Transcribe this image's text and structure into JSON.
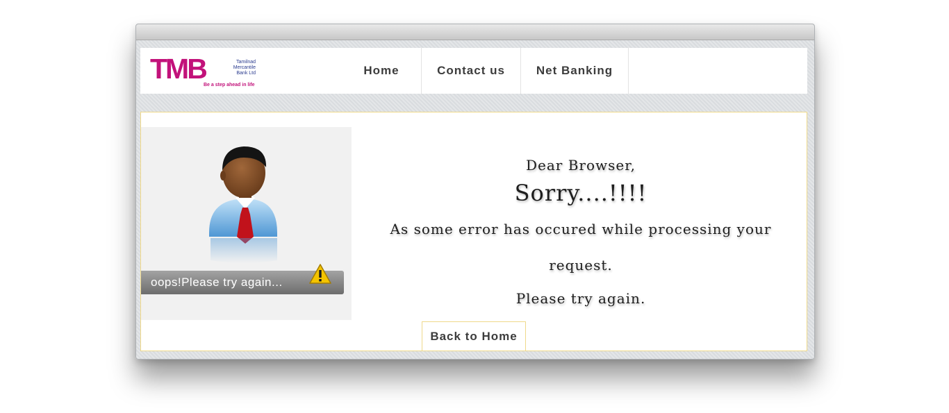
{
  "header": {
    "logo": {
      "mark": "TMB",
      "bank_name": "Tamilnad Mercantile Bank Ltd",
      "tagline": "Be a step ahead in life"
    },
    "nav": [
      {
        "label": "Home"
      },
      {
        "label": "Contact us"
      },
      {
        "label": "Net Banking"
      }
    ]
  },
  "error": {
    "illustration_caption": "oops!Please try again...",
    "greeting": "Dear Browser,",
    "headline": "Sorry....!!!!",
    "message": "As some error has occured while processing your request.",
    "retry": "Please try again."
  },
  "back_button": {
    "label": "Back to Home"
  },
  "colors": {
    "brand": "#c2127a",
    "brand_secondary": "#2a3b8f",
    "content_border": "#efd98a"
  }
}
